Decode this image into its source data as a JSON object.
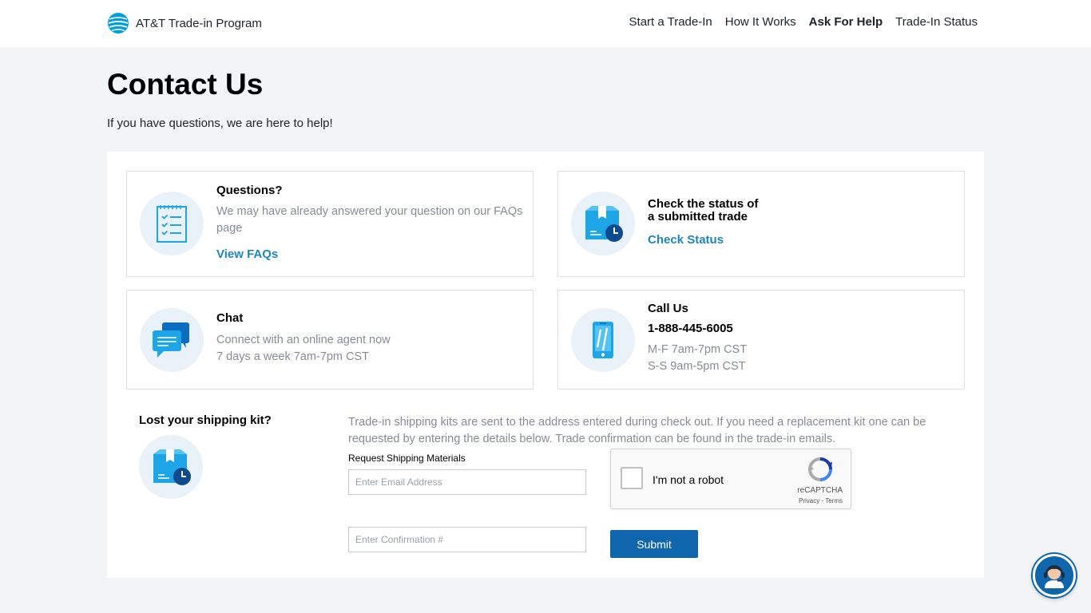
{
  "header": {
    "brand": "AT&T Trade-in Program",
    "nav": [
      {
        "label": "Start a Trade-In"
      },
      {
        "label": "How It Works"
      },
      {
        "label": "Ask For Help"
      },
      {
        "label": "Trade-In Status"
      }
    ]
  },
  "page": {
    "title": "Contact Us",
    "subtitle": "If you have questions, we are here to help!"
  },
  "cards": {
    "faq": {
      "title": "Questions?",
      "desc": "We may have already answered your question on our FAQs page",
      "link": "View FAQs",
      "icon": "checklist-icon"
    },
    "status": {
      "title_line1": "Check the status of",
      "title_line2": "a submitted trade",
      "link": "Check Status",
      "icon": "package-clock-icon"
    },
    "chat": {
      "title": "Chat",
      "desc_line1": "Connect with an online agent now",
      "desc_line2": "7 days a week 7am-7pm CST",
      "icon": "chat-bubbles-icon"
    },
    "call": {
      "title": "Call Us",
      "phone": "1-888-445-6005",
      "hours_line1": "M-F 7am-7pm CST",
      "hours_line2": "S-S 9am-5pm CST",
      "icon": "smartphone-icon"
    }
  },
  "kit": {
    "title": "Lost your shipping kit?",
    "desc": "Trade-in shipping kits are sent to the address entered during check out. If you need a replacement kit one can be requested by entering the details below. Trade confirmation can be found in the trade-in emails.",
    "label": "Request Shipping Materials",
    "email_placeholder": "Enter Email Address",
    "confirmation_placeholder": "Enter Confirmation #",
    "submit_label": "Submit"
  },
  "captcha": {
    "label": "I'm not a robot",
    "brand": "reCAPTCHA",
    "links": "Privacy - Terms"
  },
  "colors": {
    "accent": "#1d85bf",
    "button": "#0f66ad",
    "icon_blue": "#1ea5e8"
  }
}
